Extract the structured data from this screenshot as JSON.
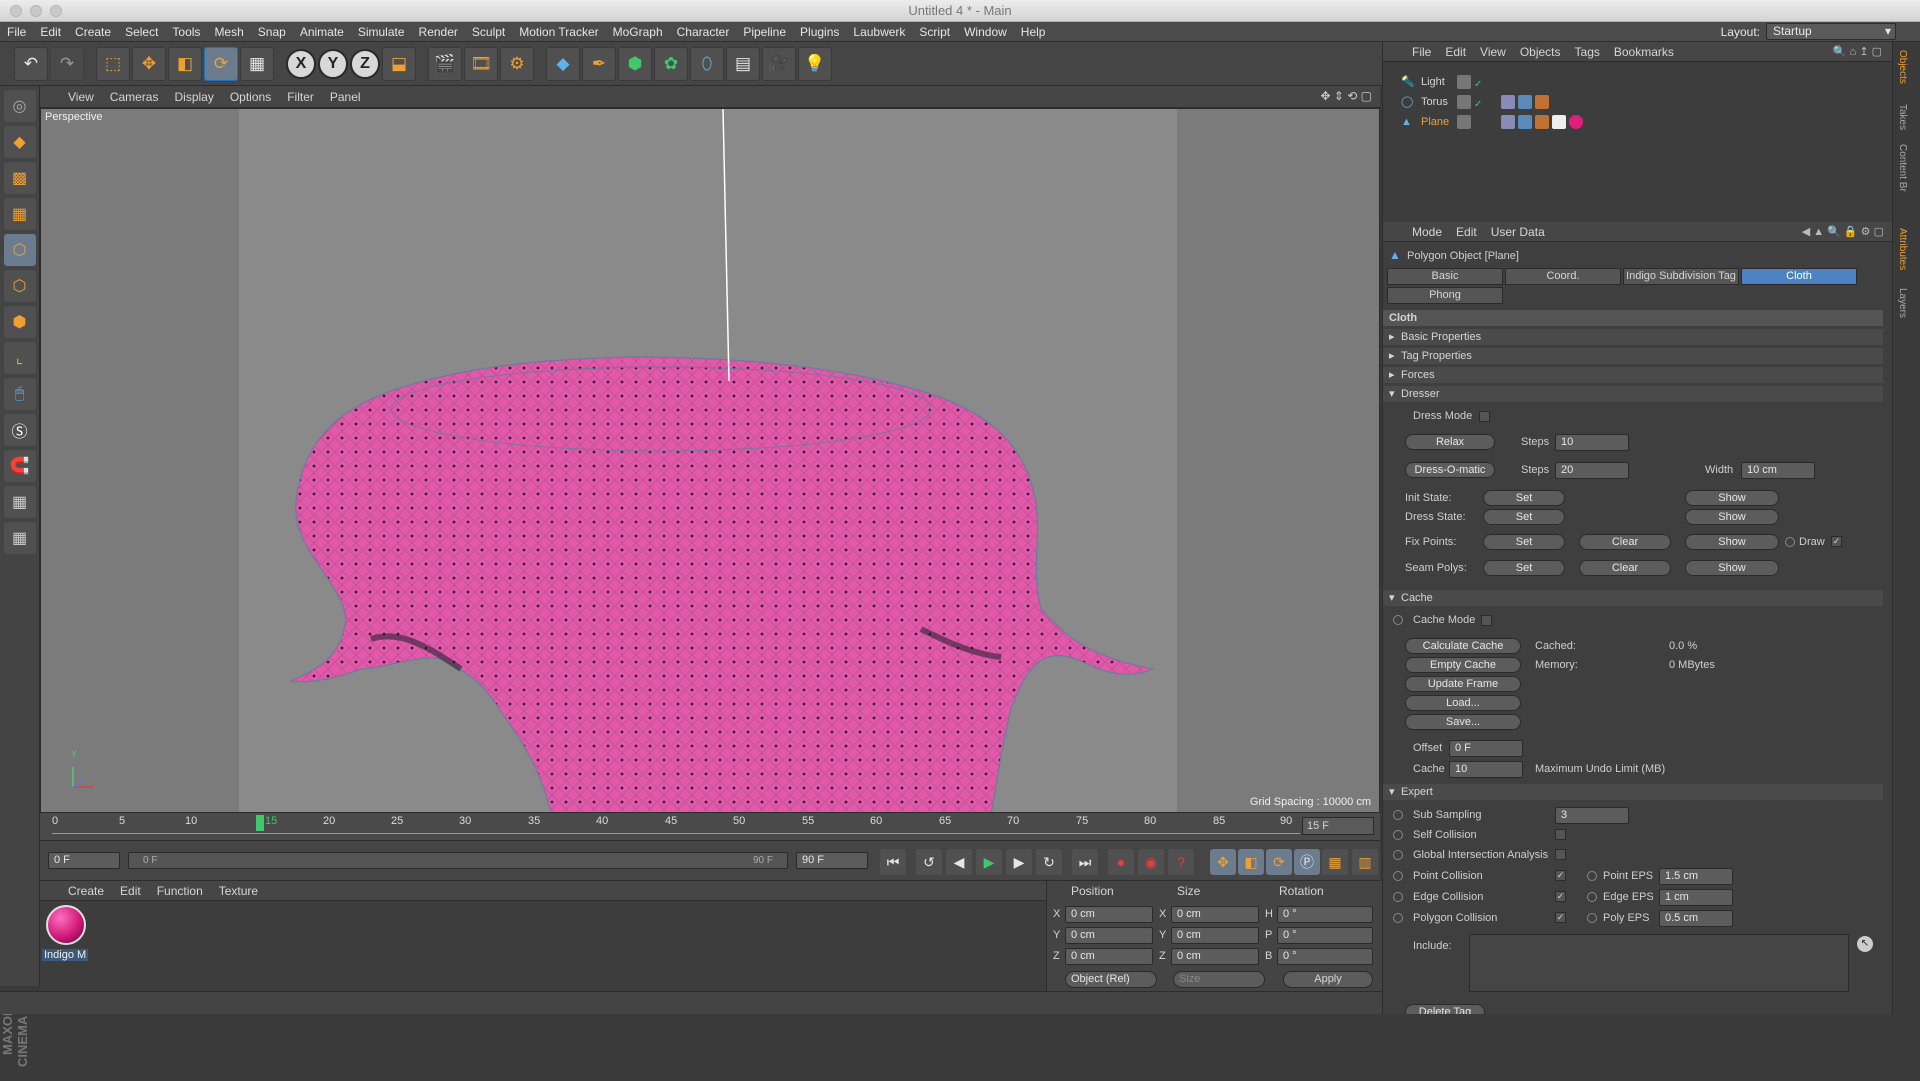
{
  "window": {
    "title": "Untitled 4 * - Main"
  },
  "menu": [
    "File",
    "Edit",
    "Create",
    "Select",
    "Tools",
    "Mesh",
    "Snap",
    "Animate",
    "Simulate",
    "Render",
    "Sculpt",
    "Motion Tracker",
    "MoGraph",
    "Character",
    "Pipeline",
    "Plugins",
    "Laubwerk",
    "Script",
    "Window",
    "Help"
  ],
  "layout": {
    "label": "Layout:",
    "value": "Startup"
  },
  "toolbar_icons": [
    "undo-icon",
    "redo-icon",
    "live-select-icon",
    "move-icon",
    "scale-icon",
    "rotate-icon",
    "tool-icon",
    "x-axis-icon",
    "y-axis-icon",
    "z-axis-icon",
    "coordinate-system-icon",
    "render-view-icon",
    "render-picture-viewer-icon",
    "render-settings-icon",
    "cube-icon",
    "pen-icon",
    "subdivision-icon",
    "cloner-icon",
    "deformer-icon",
    "floor-icon",
    "camera-icon",
    "light-icon"
  ],
  "axis": {
    "x": "X",
    "y": "Y",
    "z": "Z"
  },
  "viewport": {
    "menu": [
      "View",
      "Cameras",
      "Display",
      "Options",
      "Filter",
      "Panel"
    ],
    "label": "Perspective",
    "grid_spacing": "Grid Spacing : 10000 cm",
    "axis_y": "Y"
  },
  "timeline": {
    "ticks": [
      "0",
      "5",
      "10",
      "15",
      "20",
      "25",
      "30",
      "35",
      "40",
      "45",
      "50",
      "55",
      "60",
      "65",
      "70",
      "75",
      "80",
      "85",
      "90"
    ],
    "current_frame_label": "15",
    "current_frame": "15 F",
    "start": "0 F",
    "range_start": "0 F",
    "range_end": "90 F",
    "end": "90 F"
  },
  "materials": {
    "menu": [
      "Create",
      "Edit",
      "Function",
      "Texture"
    ],
    "items": [
      {
        "name": "Indigo M"
      }
    ]
  },
  "coords": {
    "headers": {
      "position": "Position",
      "size": "Size",
      "rotation": "Rotation"
    },
    "rows": [
      {
        "axis": "X",
        "pos": "0 cm",
        "size_axis": "X",
        "size": "0 cm",
        "rot_axis": "H",
        "rot": "0 °"
      },
      {
        "axis": "Y",
        "pos": "0 cm",
        "size_axis": "Y",
        "size": "0 cm",
        "rot_axis": "P",
        "rot": "0 °"
      },
      {
        "axis": "Z",
        "pos": "0 cm",
        "size_axis": "Z",
        "size": "0 cm",
        "rot_axis": "B",
        "rot": "0 °"
      }
    ],
    "mode": "Object (Rel)",
    "size_mode": "Size",
    "apply": "Apply"
  },
  "objects": {
    "menu": [
      "File",
      "Edit",
      "View",
      "Objects",
      "Tags",
      "Bookmarks"
    ],
    "items": [
      {
        "name": "Light",
        "active": false
      },
      {
        "name": "Torus",
        "active": false
      },
      {
        "name": "Plane",
        "active": true
      }
    ]
  },
  "attributes": {
    "menu": [
      "Mode",
      "Edit",
      "User Data"
    ],
    "object_title": "Polygon Object [Plane]",
    "tabs": [
      "Basic",
      "Coord.",
      "Indigo Subdivision Tag",
      "Cloth",
      "Phong"
    ],
    "active_tab": "Cloth",
    "section_title": "Cloth",
    "collapsed": [
      "Basic Properties",
      "Tag Properties",
      "Forces"
    ],
    "dresser": {
      "title": "Dresser",
      "dress_mode": "Dress Mode",
      "relax": "Relax",
      "steps_label": "Steps",
      "relax_steps": "10",
      "dressomatic": "Dress-O-matic",
      "dress_steps": "20",
      "width_label": "Width",
      "width": "10 cm",
      "init_state": "Init State:",
      "dress_state": "Dress State:",
      "fix_points": "Fix Points:",
      "seam_polys": "Seam Polys:",
      "set": "Set",
      "show": "Show",
      "clear": "Clear",
      "draw": "Draw"
    },
    "cache": {
      "title": "Cache",
      "cache_mode": "Cache Mode",
      "calculate": "Calculate Cache",
      "empty": "Empty Cache",
      "update": "Update Frame",
      "load": "Load...",
      "save": "Save...",
      "cached_label": "Cached:",
      "cached": "0.0 %",
      "memory_label": "Memory:",
      "memory": "0 MBytes",
      "offset_label": "Offset",
      "offset": "0 F",
      "cache_label": "Cache",
      "cache_value": "10",
      "undo_label": "Maximum Undo Limit (MB)"
    },
    "expert": {
      "title": "Expert",
      "sub_sampling": "Sub Sampling",
      "sub_sampling_value": "3",
      "self_collision": "Self Collision",
      "global_intersection": "Global Intersection Analysis",
      "point_collision": "Point Collision",
      "point_eps_label": "Point EPS",
      "point_eps": "1.5 cm",
      "edge_collision": "Edge Collision",
      "edge_eps_label": "Edge EPS",
      "edge_eps": "1 cm",
      "polygon_collision": "Polygon Collision",
      "poly_eps_label": "Poly EPS",
      "poly_eps": "0.5 cm",
      "include": "Include:"
    },
    "delete_tag": "Delete Tag"
  },
  "side_tabs": [
    "Objects",
    "Takes",
    "Content Br",
    "Attributes",
    "Layers"
  ],
  "colors": {
    "accent": "#4d83c2",
    "cloth": "#e05aa8",
    "active": "#f0a030"
  }
}
